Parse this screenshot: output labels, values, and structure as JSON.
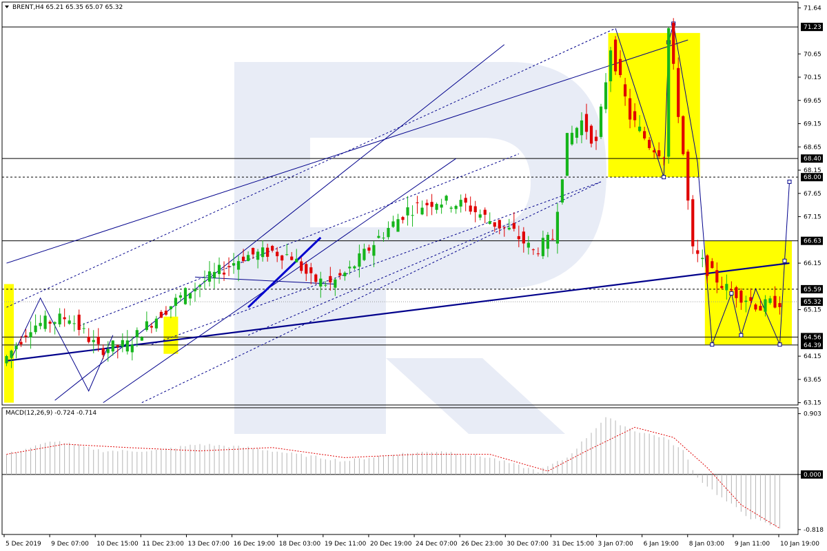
{
  "header": {
    "symbol_line": "BRENT,H4  65.21 65.35 65.07 65.32",
    "macd_line": "MACD(12,26,9) -0.724 -0.714"
  },
  "chart_data": {
    "type": "candlestick",
    "symbol": "BRENT",
    "timeframe": "H4",
    "ohlc_header": {
      "open": 65.21,
      "high": 65.35,
      "low": 65.07,
      "close": 65.32
    },
    "price_axis_ticks": [
      "71.64",
      "70.65",
      "70.15",
      "69.65",
      "69.15",
      "68.65",
      "68.15",
      "67.65",
      "67.15",
      "66.15",
      "65.15",
      "64.15",
      "63.65",
      "63.15"
    ],
    "highlighted_levels": [
      {
        "label": "71.23",
        "value": 71.23,
        "style": "solid"
      },
      {
        "label": "68.40",
        "value": 68.4,
        "style": "solid"
      },
      {
        "label": "68.00",
        "value": 68.0,
        "style": "dashed"
      },
      {
        "label": "66.63",
        "value": 66.63,
        "style": "solid"
      },
      {
        "label": "65.59",
        "value": 65.59,
        "style": "dashed"
      },
      {
        "label": "65.32",
        "value": 65.32,
        "style": "current"
      },
      {
        "label": "64.56",
        "value": 64.56,
        "style": "solid"
      },
      {
        "label": "64.39",
        "value": 64.39,
        "style": "solid"
      }
    ],
    "y_range": [
      63.1,
      71.75
    ],
    "time_labels": [
      "5 Dec 2019",
      "9 Dec 07:00",
      "10 Dec 15:00",
      "11 Dec 23:00",
      "13 Dec 07:00",
      "16 Dec 19:00",
      "18 Dec 03:00",
      "19 Dec 11:00",
      "20 Dec 19:00",
      "24 Dec 07:00",
      "26 Dec 23:00",
      "30 Dec 07:00",
      "31 Dec 15:00",
      "3 Jan 07:00",
      "6 Jan 19:00",
      "8 Jan 03:00",
      "9 Jan 11:00",
      "10 Jan 19:00"
    ],
    "candle_anchors": [
      {
        "i": 0,
        "price": 64.0
      },
      {
        "i": 6,
        "price": 64.8
      },
      {
        "i": 14,
        "price": 65.0
      },
      {
        "i": 20,
        "price": 64.3
      },
      {
        "i": 26,
        "price": 64.4
      },
      {
        "i": 32,
        "price": 65.0
      },
      {
        "i": 38,
        "price": 65.5
      },
      {
        "i": 44,
        "price": 65.9
      },
      {
        "i": 50,
        "price": 66.3
      },
      {
        "i": 56,
        "price": 66.4
      },
      {
        "i": 60,
        "price": 66.3
      },
      {
        "i": 64,
        "price": 65.8
      },
      {
        "i": 68,
        "price": 65.7
      },
      {
        "i": 72,
        "price": 66.0
      },
      {
        "i": 78,
        "price": 66.7
      },
      {
        "i": 84,
        "price": 67.3
      },
      {
        "i": 90,
        "price": 67.5
      },
      {
        "i": 96,
        "price": 67.4
      },
      {
        "i": 102,
        "price": 67.0
      },
      {
        "i": 106,
        "price": 66.8
      },
      {
        "i": 110,
        "price": 66.4
      },
      {
        "i": 114,
        "price": 66.7
      },
      {
        "i": 117,
        "price": 68.8
      },
      {
        "i": 120,
        "price": 69.2
      },
      {
        "i": 123,
        "price": 68.7
      },
      {
        "i": 126,
        "price": 70.8
      },
      {
        "i": 130,
        "price": 69.3
      },
      {
        "i": 134,
        "price": 68.7
      },
      {
        "i": 137,
        "price": 68.5
      },
      {
        "i": 138,
        "price": 71.2
      },
      {
        "i": 141,
        "price": 68.5
      },
      {
        "i": 143,
        "price": 66.4
      },
      {
        "i": 147,
        "price": 65.9
      },
      {
        "i": 150,
        "price": 65.6
      },
      {
        "i": 154,
        "price": 65.4
      },
      {
        "i": 157,
        "price": 65.2
      },
      {
        "i": 160,
        "price": 65.32
      }
    ],
    "macd": {
      "label": "MACD(12,26,9)",
      "main": -0.724,
      "signal": -0.714,
      "axis_ticks": [
        "0.903",
        "0.000",
        "-0.818"
      ],
      "y_range": [
        -0.85,
        0.95
      ],
      "hist_anchors": [
        {
          "i": 0,
          "v": 0.3
        },
        {
          "i": 10,
          "v": 0.5
        },
        {
          "i": 20,
          "v": 0.35
        },
        {
          "i": 30,
          "v": 0.35
        },
        {
          "i": 40,
          "v": 0.45
        },
        {
          "i": 50,
          "v": 0.4
        },
        {
          "i": 60,
          "v": 0.3
        },
        {
          "i": 70,
          "v": 0.2
        },
        {
          "i": 80,
          "v": 0.3
        },
        {
          "i": 90,
          "v": 0.35
        },
        {
          "i": 100,
          "v": 0.25
        },
        {
          "i": 110,
          "v": 0.05
        },
        {
          "i": 116,
          "v": 0.25
        },
        {
          "i": 124,
          "v": 0.85
        },
        {
          "i": 130,
          "v": 0.65
        },
        {
          "i": 136,
          "v": 0.55
        },
        {
          "i": 140,
          "v": 0.35
        },
        {
          "i": 143,
          "v": -0.05
        },
        {
          "i": 148,
          "v": -0.35
        },
        {
          "i": 154,
          "v": -0.65
        },
        {
          "i": 160,
          "v": -0.8
        }
      ],
      "signal_anchors": [
        {
          "i": 0,
          "v": 0.3
        },
        {
          "i": 12,
          "v": 0.45
        },
        {
          "i": 25,
          "v": 0.4
        },
        {
          "i": 40,
          "v": 0.35
        },
        {
          "i": 55,
          "v": 0.4
        },
        {
          "i": 70,
          "v": 0.25
        },
        {
          "i": 85,
          "v": 0.3
        },
        {
          "i": 100,
          "v": 0.3
        },
        {
          "i": 112,
          "v": 0.05
        },
        {
          "i": 120,
          "v": 0.35
        },
        {
          "i": 130,
          "v": 0.7
        },
        {
          "i": 138,
          "v": 0.55
        },
        {
          "i": 145,
          "v": 0.1
        },
        {
          "i": 152,
          "v": -0.45
        },
        {
          "i": 160,
          "v": -0.8
        }
      ]
    },
    "highlight_boxes": [
      {
        "from_i": 0,
        "to_i": 1,
        "low": 63.15,
        "high": 65.7
      },
      {
        "from_i": 33,
        "to_i": 35,
        "low": 64.2,
        "high": 65.0
      },
      {
        "from_i": 125,
        "to_i": 143,
        "low": 68.0,
        "high": 71.1
      },
      {
        "from_i": 145,
        "to_i": 162,
        "low": 64.4,
        "high": 66.63
      }
    ],
    "colors": {
      "up": "#16b51c",
      "down": "#e00000",
      "box": "#ffff00",
      "trend_line": "#00008b",
      "macd_hist": "#b4b4b4",
      "macd_signal": "#e00000",
      "watermark": "#e4e8f5"
    }
  }
}
